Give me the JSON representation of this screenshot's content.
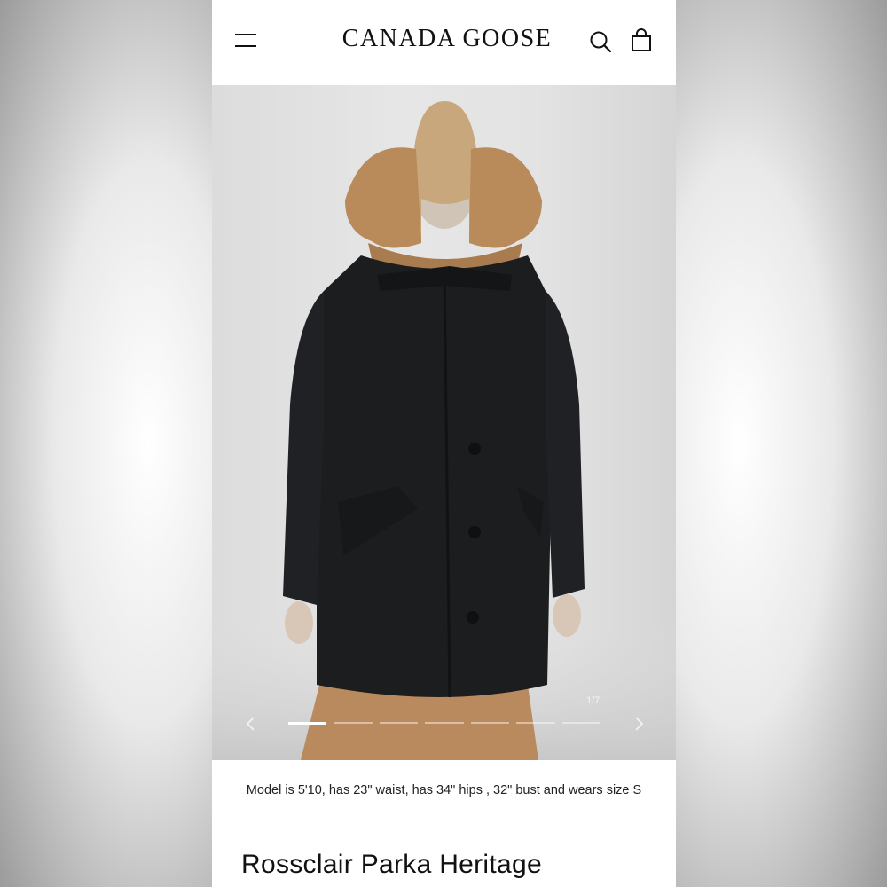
{
  "header": {
    "brand": "CANADA GOOSE",
    "menu_icon": "hamburger-icon",
    "search_icon": "search-icon",
    "bag_icon": "shopping-bag-icon"
  },
  "gallery": {
    "counter": "1/7",
    "total_slides": 7,
    "active_slide": 1,
    "prev_icon": "chevron-left-icon",
    "next_icon": "chevron-right-icon"
  },
  "product": {
    "model_caption": "Model is 5'10, has 23\" waist, has 34\" hips , 32\" bust and wears size S",
    "title": "Rossclair Parka Heritage"
  },
  "colors": {
    "text": "#111111",
    "background": "#ffffff",
    "parka": "#1c1d1f",
    "fur": "#b98a5a",
    "skirt": "#b88a5e"
  }
}
